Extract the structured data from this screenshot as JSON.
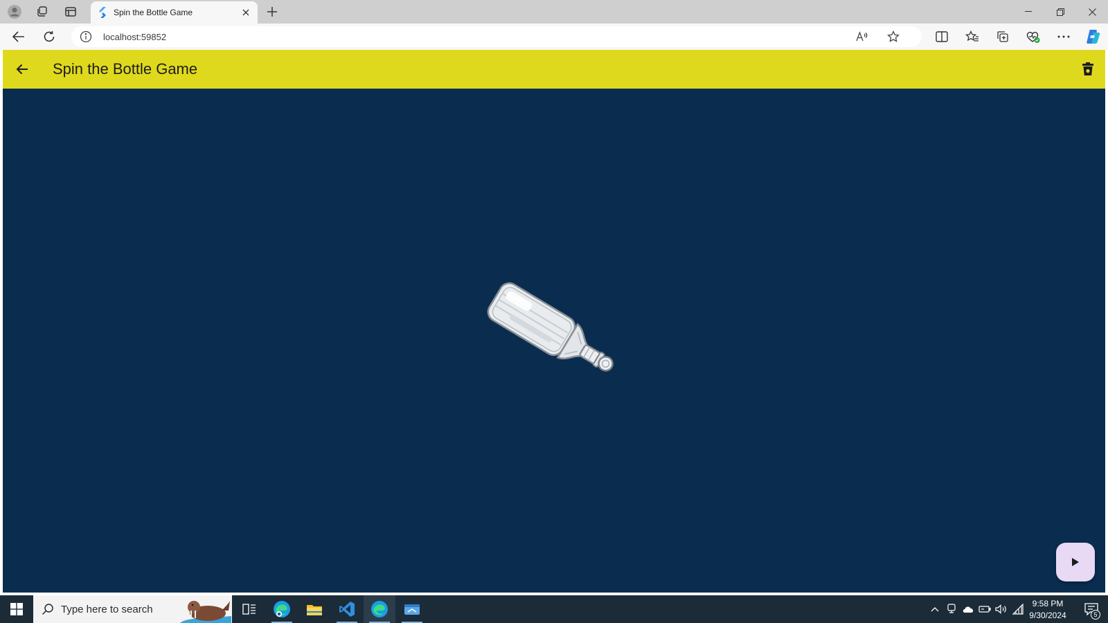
{
  "browser": {
    "tab": {
      "title": "Spin the Bottle Game"
    },
    "address": {
      "url": "localhost:59852"
    }
  },
  "app": {
    "title": "Spin the Bottle Game",
    "colors": {
      "appbar": "#dfd91d",
      "background": "#0a2d4f",
      "fab": "#e8d9f4"
    },
    "icons": {
      "back": "arrow-left-icon",
      "action": "delete-bin-icon",
      "fab": "play-icon"
    }
  },
  "taskbar": {
    "search_placeholder": "Type here to search",
    "clock": {
      "time": "9:58 PM",
      "date": "9/30/2024"
    },
    "notification_count": "5"
  }
}
